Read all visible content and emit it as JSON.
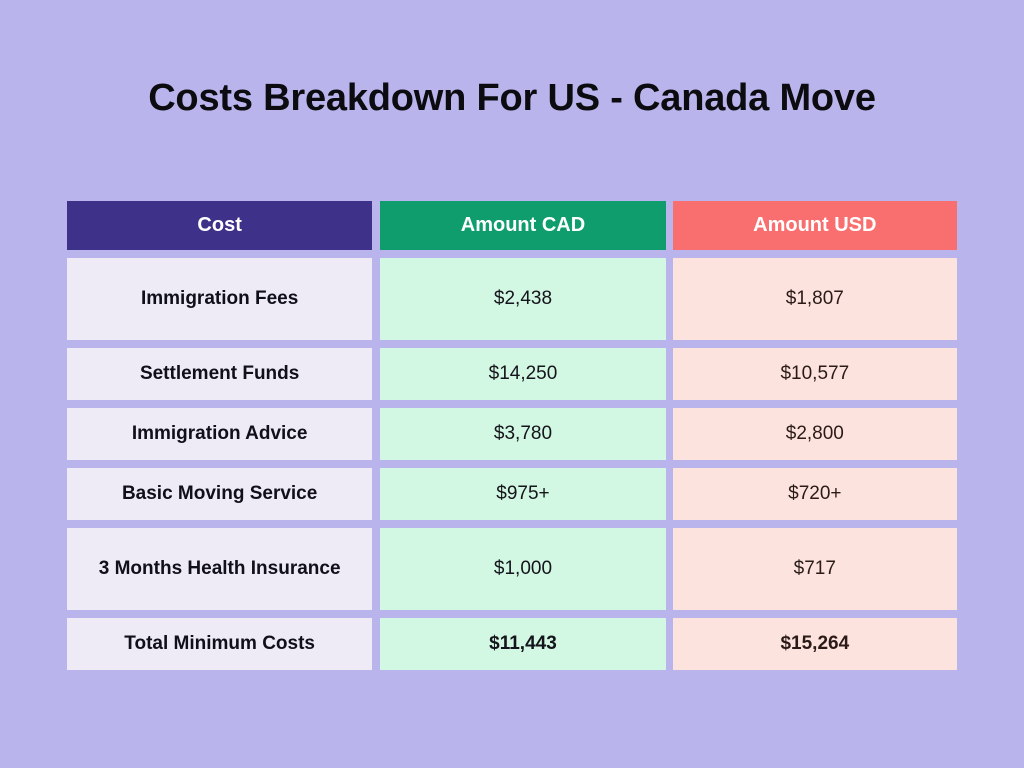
{
  "page": {
    "title": "Costs Breakdown For US - Canada Move",
    "background_color": "#b9b5ec"
  },
  "table": {
    "headers": {
      "cost": "Cost",
      "amount_cad": "Amount CAD",
      "amount_usd": "Amount USD"
    },
    "header_colors": {
      "cost": "#3d3189",
      "amount_cad": "#0f9d6e",
      "amount_usd": "#f96f6f"
    },
    "cell_colors": {
      "cost": "#eeebf7",
      "amount_cad": "#d2f7e2",
      "amount_usd": "#fde3dd"
    },
    "rows": [
      {
        "label": "Immigration Fees",
        "cad": "$2,438",
        "usd": "$1,807"
      },
      {
        "label": "Settlement Funds",
        "cad": "$14,250",
        "usd": "$10,577"
      },
      {
        "label": "Immigration Advice",
        "cad": "$3,780",
        "usd": "$2,800"
      },
      {
        "label": "Basic Moving Service",
        "cad": "$975+",
        "usd": "$720+"
      },
      {
        "label": "3 Months Health Insurance",
        "cad": "$1,000",
        "usd": "$717"
      },
      {
        "label": "Total Minimum Costs",
        "cad": "$11,443",
        "usd": "$15,264"
      }
    ]
  },
  "chart_data": {
    "type": "table",
    "title": "Costs Breakdown For US - Canada Move",
    "columns": [
      "Cost",
      "Amount CAD",
      "Amount USD"
    ],
    "rows": [
      [
        "Immigration Fees",
        "$2,438",
        "$1,807"
      ],
      [
        "Settlement Funds",
        "$14,250",
        "$10,577"
      ],
      [
        "Immigration Advice",
        "$3,780",
        "$2,800"
      ],
      [
        "Basic Moving Service",
        "$975+",
        "$720+"
      ],
      [
        "3 Months Health Insurance",
        "$1,000",
        "$717"
      ],
      [
        "Total Minimum Costs",
        "$11,443",
        "$15,264"
      ]
    ],
    "categories": [
      "Immigration Fees",
      "Settlement Funds",
      "Immigration Advice",
      "Basic Moving Service",
      "3 Months Health Insurance",
      "Total Minimum Costs"
    ],
    "series": [
      {
        "name": "Amount CAD",
        "values": [
          2438,
          14250,
          3780,
          975,
          1000,
          11443
        ]
      },
      {
        "name": "Amount USD",
        "values": [
          1807,
          10577,
          2800,
          720,
          717,
          15264
        ]
      }
    ],
    "xlabel": "Cost",
    "ylabel": "Amount",
    "legend_position": "top"
  }
}
